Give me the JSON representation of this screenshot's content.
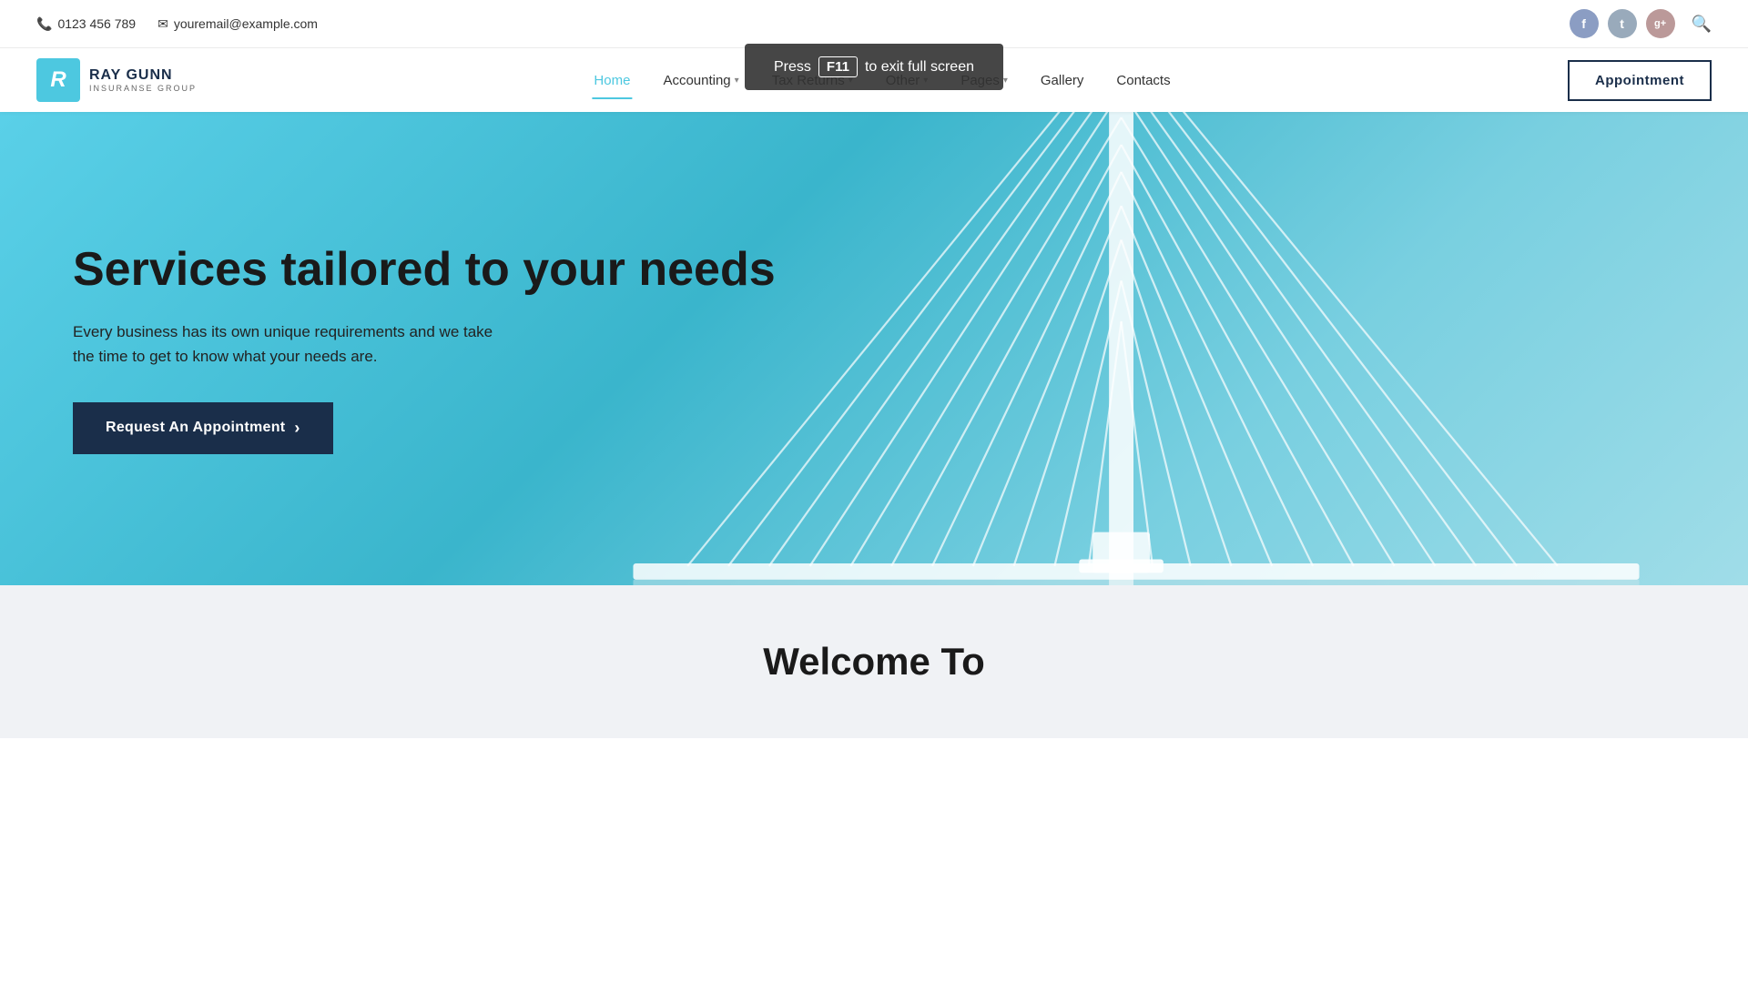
{
  "topbar": {
    "phone": "0123 456 789",
    "email": "youremail@example.com"
  },
  "f11_tooltip": {
    "press": "Press",
    "key": "F11",
    "message": "to exit full screen"
  },
  "navbar": {
    "logo_letter": "R",
    "logo_name": "Ray Gunn",
    "logo_sub": "INSURANSE GROUP",
    "appointment_label": "Appointment",
    "nav_items": [
      {
        "label": "Home",
        "active": true,
        "has_dropdown": false
      },
      {
        "label": "Accounting",
        "active": false,
        "has_dropdown": true
      },
      {
        "label": "Tax Returns",
        "active": false,
        "has_dropdown": true
      },
      {
        "label": "Other",
        "active": false,
        "has_dropdown": true
      },
      {
        "label": "Pages",
        "active": false,
        "has_dropdown": true
      },
      {
        "label": "Gallery",
        "active": false,
        "has_dropdown": false
      },
      {
        "label": "Contacts",
        "active": false,
        "has_dropdown": false
      }
    ]
  },
  "hero": {
    "title": "Services tailored to your needs",
    "subtitle": "Every business has its own unique requirements and we take the time to get to know what your needs are.",
    "cta_label": "Request An Appointment",
    "cta_arrow": "›"
  },
  "below_hero": {
    "title": "Welcome To"
  },
  "social": {
    "facebook": "f",
    "twitter": "t",
    "googleplus": "g+"
  }
}
